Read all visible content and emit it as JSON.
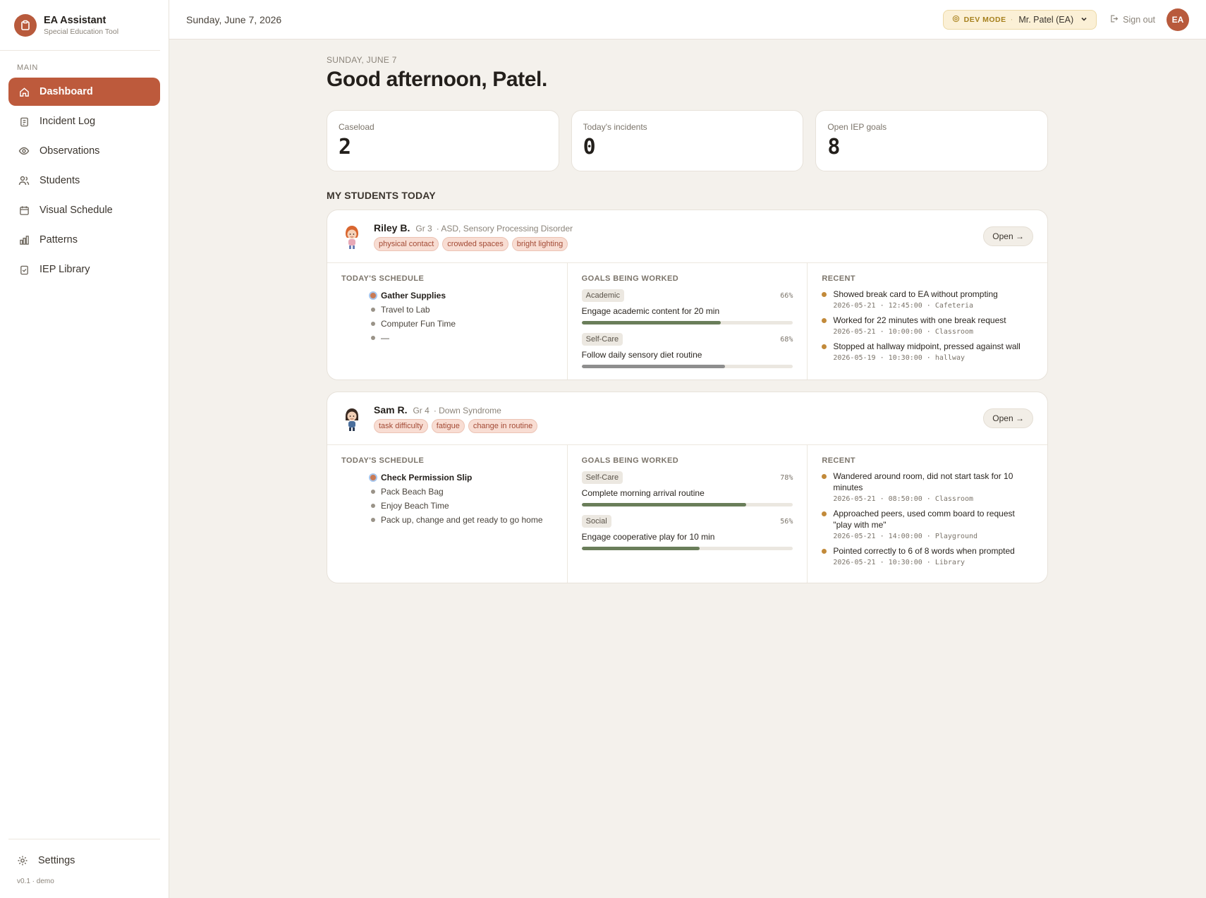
{
  "app": {
    "title": "EA Assistant",
    "subtitle": "Special Education Tool",
    "version": "v0.1 · demo"
  },
  "sidebar": {
    "section": "MAIN",
    "items": [
      {
        "label": "Dashboard",
        "icon": "home-icon",
        "active": true
      },
      {
        "label": "Incident Log",
        "icon": "clipboard-icon"
      },
      {
        "label": "Observations",
        "icon": "eye-icon"
      },
      {
        "label": "Students",
        "icon": "users-icon"
      },
      {
        "label": "Visual Schedule",
        "icon": "calendar-icon"
      },
      {
        "label": "Patterns",
        "icon": "bar-chart-icon"
      },
      {
        "label": "IEP Library",
        "icon": "clipboard-check-icon"
      }
    ],
    "settings": "Settings"
  },
  "topbar": {
    "date": "Sunday, June 7, 2026",
    "dev_mode": "DEV MODE",
    "dev_user": "Mr. Patel (EA)",
    "sign_out": "Sign out",
    "avatar_initials": "EA"
  },
  "main": {
    "eyebrow": "SUNDAY, JUNE 7",
    "greeting": "Good afternoon, Patel.",
    "stats": [
      {
        "label": "Caseload",
        "value": "2"
      },
      {
        "label": "Today's incidents",
        "value": "0"
      },
      {
        "label": "Open IEP goals",
        "value": "8"
      }
    ],
    "section_title": "MY STUDENTS TODAY",
    "col_titles": {
      "schedule": "TODAY'S SCHEDULE",
      "goals": "GOALS BEING WORKED",
      "recent": "RECENT"
    },
    "open_label": "Open →"
  },
  "students": [
    {
      "name": "Riley B.",
      "grade": "Gr 3",
      "diagnosis": "· ASD, Sensory Processing Disorder",
      "triggers": [
        "physical contact",
        "crowded spaces",
        "bright lighting"
      ],
      "schedule": [
        "Gather Supplies",
        "Travel to Lab",
        "Computer Fun Time",
        "—"
      ],
      "goals": [
        {
          "domain": "Academic",
          "text": "Engage academic content for 20 min",
          "pct_label": "66%",
          "progress": 0.66,
          "color": "#6a7e5a"
        },
        {
          "domain": "Self-Care",
          "text": "Follow daily sensory diet routine",
          "pct_label": "68%",
          "progress": 0.68,
          "color": "#8e8e8e"
        }
      ],
      "recent": [
        {
          "text": "Showed break card to EA without prompting",
          "meta": "2026-05-21 · 12:45:00 · Cafeteria"
        },
        {
          "text": "Worked for 22 minutes with one break request",
          "meta": "2026-05-21 · 10:00:00 · Classroom"
        },
        {
          "text": "Stopped at hallway midpoint, pressed against wall",
          "meta": "2026-05-19 · 10:30:00 · hallway"
        }
      ]
    },
    {
      "name": "Sam R.",
      "grade": "Gr 4",
      "diagnosis": "· Down Syndrome",
      "triggers": [
        "task difficulty",
        "fatigue",
        "change in routine"
      ],
      "schedule": [
        "Check Permission Slip",
        "Pack Beach Bag",
        "Enjoy Beach Time",
        "Pack up, change and get ready to go home"
      ],
      "goals": [
        {
          "domain": "Self-Care",
          "text": "Complete morning arrival routine",
          "pct_label": "78%",
          "progress": 0.78,
          "color": "#6a7e5a"
        },
        {
          "domain": "Social",
          "text": "Engage cooperative play for 10 min",
          "pct_label": "56%",
          "progress": 0.56,
          "color": "#6a7e5a"
        }
      ],
      "recent": [
        {
          "text": "Wandered around room, did not start task for 10 minutes",
          "meta": "2026-05-21 · 08:50:00 · Classroom"
        },
        {
          "text": "Approached peers, used comm board to request \"play with me\"",
          "meta": "2026-05-21 · 14:00:00 · Playground"
        },
        {
          "text": "Pointed correctly to 6 of 8 words when prompted",
          "meta": "2026-05-21 · 10:30:00 · Library"
        }
      ]
    }
  ]
}
